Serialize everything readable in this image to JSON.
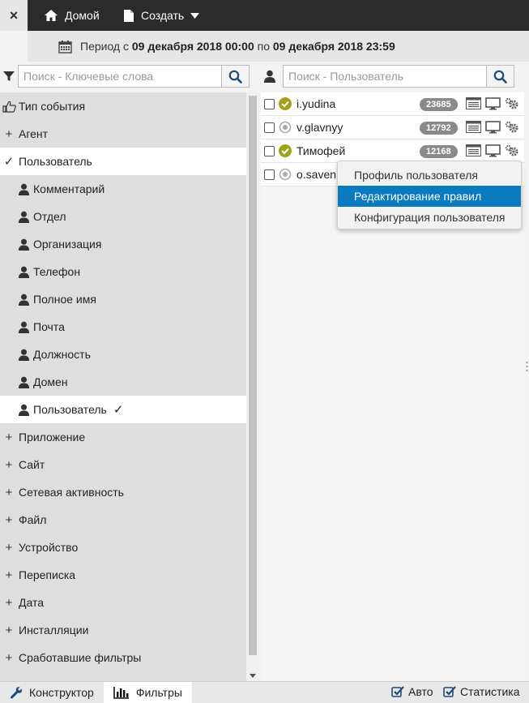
{
  "nav": {
    "close_label": "×",
    "home_label": "Домой",
    "create_label": "Создать",
    "home_icon": "home-icon",
    "create_icon": "document-icon"
  },
  "period": {
    "prefix": "Период с ",
    "from": "09 декабря 2018 00:00",
    "middle": " по ",
    "to": "09 декабря 2018 23:59"
  },
  "left_search": {
    "placeholder": "Поиск - Ключевые слова"
  },
  "right_search": {
    "placeholder": "Поиск - Пользователь"
  },
  "tree": {
    "items": [
      {
        "label": "Тип события",
        "mark": "thumb-icon"
      },
      {
        "label": "Агент",
        "mark": "+"
      },
      {
        "label": "Пользователь",
        "mark": "✓"
      },
      {
        "label": "Комментарий",
        "mark": "user-icon"
      },
      {
        "label": "Отдел",
        "mark": "user-icon"
      },
      {
        "label": "Организация",
        "mark": "user-icon"
      },
      {
        "label": "Телефон",
        "mark": "user-icon"
      },
      {
        "label": "Полное имя",
        "mark": "user-icon"
      },
      {
        "label": "Почта",
        "mark": "user-icon"
      },
      {
        "label": "Должность",
        "mark": "user-icon"
      },
      {
        "label": "Домен",
        "mark": "user-icon"
      },
      {
        "label": "Пользователь",
        "mark": "user-icon",
        "check": "✓"
      },
      {
        "label": "Приложение",
        "mark": "+"
      },
      {
        "label": "Сайт",
        "mark": "+"
      },
      {
        "label": "Сетевая активность",
        "mark": "+"
      },
      {
        "label": "Файл",
        "mark": "+"
      },
      {
        "label": "Устройство",
        "mark": "+"
      },
      {
        "label": "Переписка",
        "mark": "+"
      },
      {
        "label": "Дата",
        "mark": "+"
      },
      {
        "label": "Инсталляции",
        "mark": "+"
      },
      {
        "label": "Сработавшие фильтры",
        "mark": "+"
      }
    ]
  },
  "users": [
    {
      "name": "i.yudina",
      "count": "23685",
      "status": "online"
    },
    {
      "name": "v.glavnyy",
      "count": "12792",
      "status": "offline"
    },
    {
      "name": "Тимофей",
      "count": "12168",
      "status": "online"
    },
    {
      "name": "o.saven",
      "count": "",
      "status": "offline"
    }
  ],
  "context_menu": {
    "items": [
      {
        "label": "Профиль пользователя"
      },
      {
        "label": "Редактирование правил"
      },
      {
        "label": "Конфигурация пользователя"
      }
    ]
  },
  "bottom": {
    "constructor_label": "Конструктор",
    "filters_label": "Фильтры",
    "auto_label": "Авто",
    "stats_label": "Статистика"
  },
  "colors": {
    "topbar": "#2b2b2b",
    "accent": "#0a7bc1",
    "online": "#9da41a",
    "badge": "#8a8a8a"
  }
}
